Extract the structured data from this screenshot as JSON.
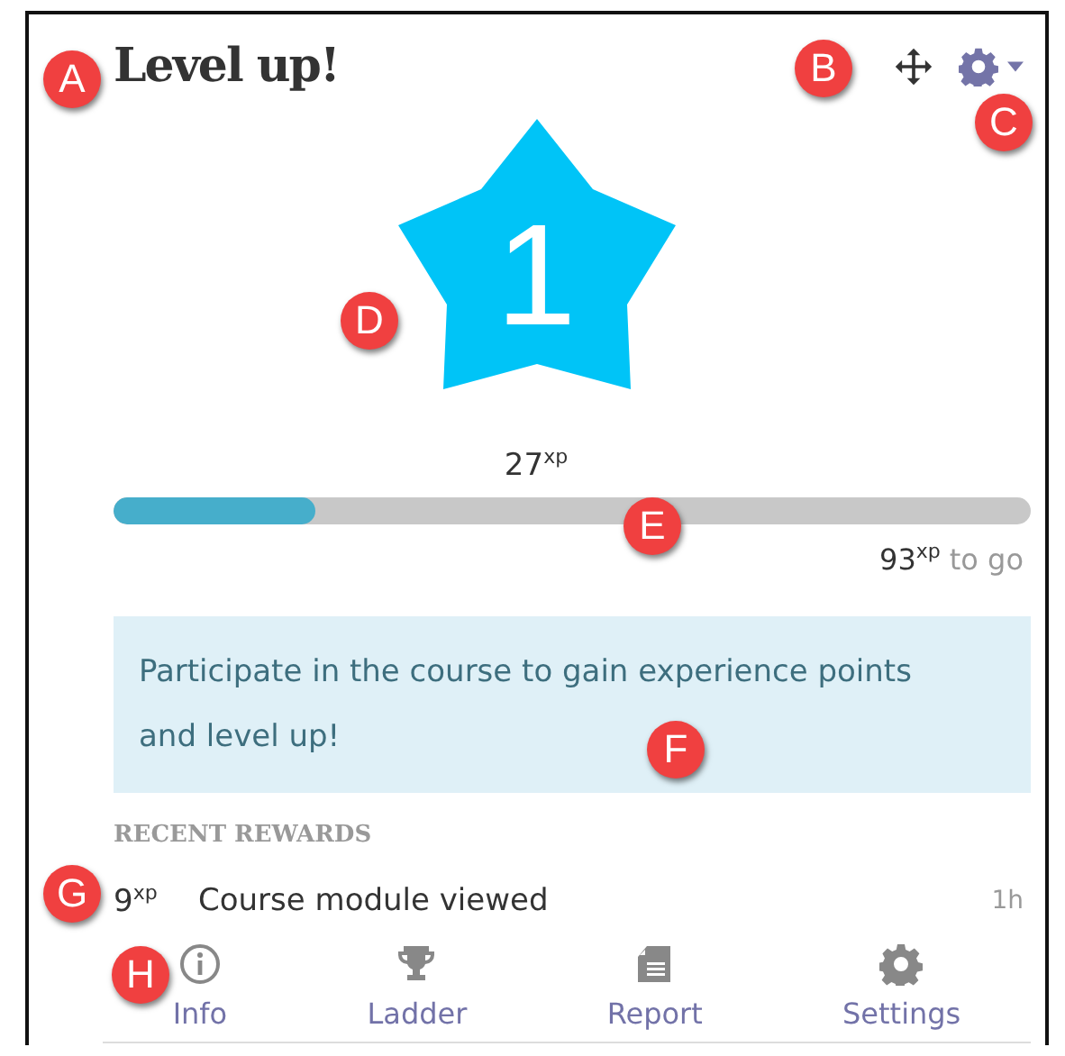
{
  "block": {
    "title": "Level up!"
  },
  "level": {
    "number": "1",
    "points": "27$^{xp}$",
    "progress": {
      "level": 0.22
    },
    "remaining": "93$^{xp}$",
    "remaining_suffix": "to go"
  },
  "message": "Participate in the course to gain experience points and level up!",
  "recent_rewards": {
    "heading": "RECENT REWARDS",
    "items": [
      {
        "points": "9$^{xp}$",
        "description": "Course module viewed",
        "time": "1h"
      }
    ]
  },
  "nav": [
    {
      "kind": "info",
      "label": "Info"
    },
    {
      "kind": "trophy",
      "label": "Ladder"
    },
    {
      "kind": "report",
      "label": "Report"
    },
    {
      "kind": "gear",
      "label": "Settings"
    }
  ],
  "callouts": [
    "A",
    "B",
    "C",
    "D",
    "E",
    "F",
    "G",
    "H"
  ]
}
